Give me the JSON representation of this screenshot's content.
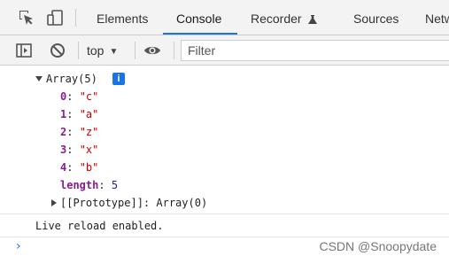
{
  "tabs": [
    {
      "label": "Elements"
    },
    {
      "label": "Console",
      "active": true
    },
    {
      "label": "Recorder"
    },
    {
      "label": "Sources"
    },
    {
      "label": "Netw"
    }
  ],
  "toolbar": {
    "context": "top",
    "filter_placeholder": "Filter"
  },
  "console": {
    "array_header": "Array(5)",
    "info_badge": "i",
    "items": [
      {
        "key": "0",
        "value": "\"c\""
      },
      {
        "key": "1",
        "value": "\"a\""
      },
      {
        "key": "2",
        "value": "\"z\""
      },
      {
        "key": "3",
        "value": "\"x\""
      },
      {
        "key": "4",
        "value": "\"b\""
      }
    ],
    "length_key": "length",
    "length_value": "5",
    "prototype_key": "[[Prototype]]",
    "prototype_value": "Array(0)",
    "log_message": "Live reload enabled.",
    "prompt": "›"
  },
  "watermark": "CSDN @Snoopydate",
  "colors": {
    "accent": "#1a73e8",
    "string": "#c80000",
    "key": "#8a1b96",
    "number": "#1a1aa6"
  },
  "icons": [
    "inspect-element-icon",
    "device-toolbar-icon",
    "recorder-flask-icon",
    "sidebar-toggle-icon",
    "clear-console-icon",
    "live-expression-eye-icon"
  ]
}
